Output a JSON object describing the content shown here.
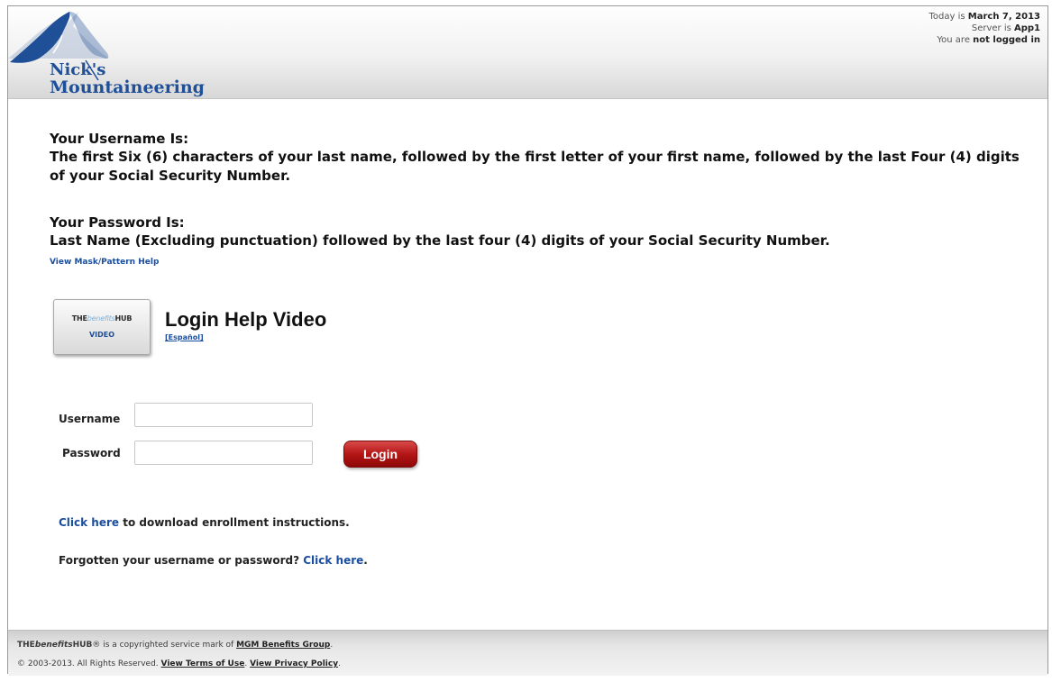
{
  "header": {
    "logo": {
      "line1": "Nick's",
      "line2": "Mountaineering"
    },
    "status": {
      "date_prefix": "Today is ",
      "date": "March 7, 2013",
      "server_prefix": "Server is ",
      "server": "App1",
      "login_prefix": "You are ",
      "login_status": "not logged in"
    }
  },
  "instructions": {
    "username_title": "Your Username Is:",
    "username_text": "The first Six (6) characters of your last name, followed by the first letter of your first name, followed by the last Four (4) digits of your Social Security Number.",
    "password_title": "Your Password Is:",
    "password_text": "Last Name (Excluding punctuation) followed by the last four (4) digits of your Social Security Number.",
    "mask_help_link": "View Mask/Pattern Help"
  },
  "video": {
    "badge_brand_the": "THE",
    "badge_brand_benefits": "benefits",
    "badge_brand_hub": "HUB",
    "badge_label": "VIDEO",
    "title": "Login Help Video",
    "spanish_link": "[Español]"
  },
  "login_form": {
    "username_label": "Username",
    "username_value": "",
    "password_label": "Password",
    "password_value": "",
    "login_button": "Login"
  },
  "links": {
    "enrollment_link": "Click here",
    "enrollment_text": " to download enrollment instructions.",
    "forgot_text": "Forgotten your username or password? ",
    "forgot_link": "Click here",
    "forgot_end": "."
  },
  "footer": {
    "brand_the": "THE",
    "brand_benefits": "benefits",
    "brand_hub": "HUB",
    "service_mark_text": "® is a copyrighted service mark of ",
    "company_link": "MGM Benefits Group",
    "period": ".",
    "copyright": "© 2003-2013.  All Rights Reserved.  ",
    "terms_link": "View Terms of Use",
    "sep": ".  ",
    "privacy_link": "View Privacy Policy",
    "period2": "."
  },
  "colors": {
    "link_blue": "#1a4ea0",
    "logo_blue": "#1f4f96",
    "login_red": "#b51616"
  },
  "icons": {
    "logo_mountain": "mountain-logo-icon"
  }
}
